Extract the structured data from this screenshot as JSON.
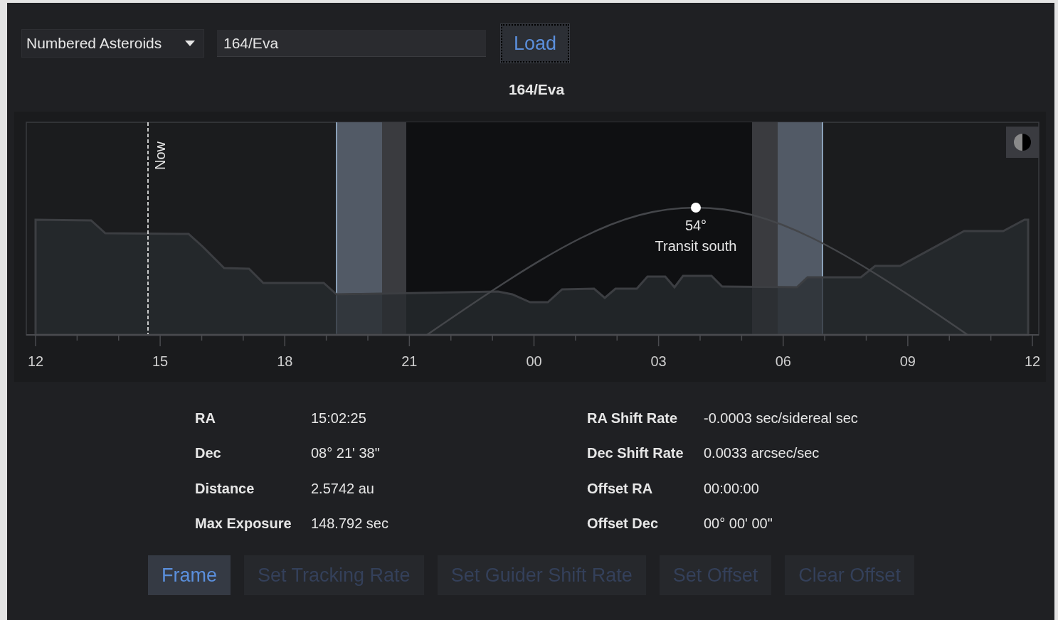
{
  "target_type": {
    "value": "Numbered Asteroids"
  },
  "target_name": {
    "value": "164/Eva"
  },
  "load_button": {
    "label": "Load",
    "focused": true
  },
  "chart": {
    "title": "164/Eva",
    "now_label": "Now",
    "transit_altitude": "54°",
    "transit_label": "Transit south",
    "x_axis_labels": [
      "12",
      "15",
      "18",
      "21",
      "00",
      "03",
      "06",
      "09",
      "12"
    ]
  },
  "details_left": [
    {
      "label": "RA",
      "value": "15:02:25"
    },
    {
      "label": "Dec",
      "value": "08° 21' 38\""
    },
    {
      "label": "Distance",
      "value": "2.5742 au"
    },
    {
      "label": "Max Exposure",
      "value": "148.792 sec"
    }
  ],
  "details_right": [
    {
      "label": "RA Shift Rate",
      "value": "-0.0003 sec/sidereal sec"
    },
    {
      "label": "Dec Shift Rate",
      "value": "0.0033 arcsec/sec"
    },
    {
      "label": "Offset RA",
      "value": "00:00:00"
    },
    {
      "label": "Offset Dec",
      "value": "00° 00' 00\""
    }
  ],
  "buttons": [
    {
      "label": "Frame",
      "disabled": false
    },
    {
      "label": "Set Tracking Rate",
      "disabled": true
    },
    {
      "label": "Set Guider Shift Rate",
      "disabled": true
    },
    {
      "label": "Set Offset",
      "disabled": true
    },
    {
      "label": "Clear Offset",
      "disabled": true
    }
  ]
}
